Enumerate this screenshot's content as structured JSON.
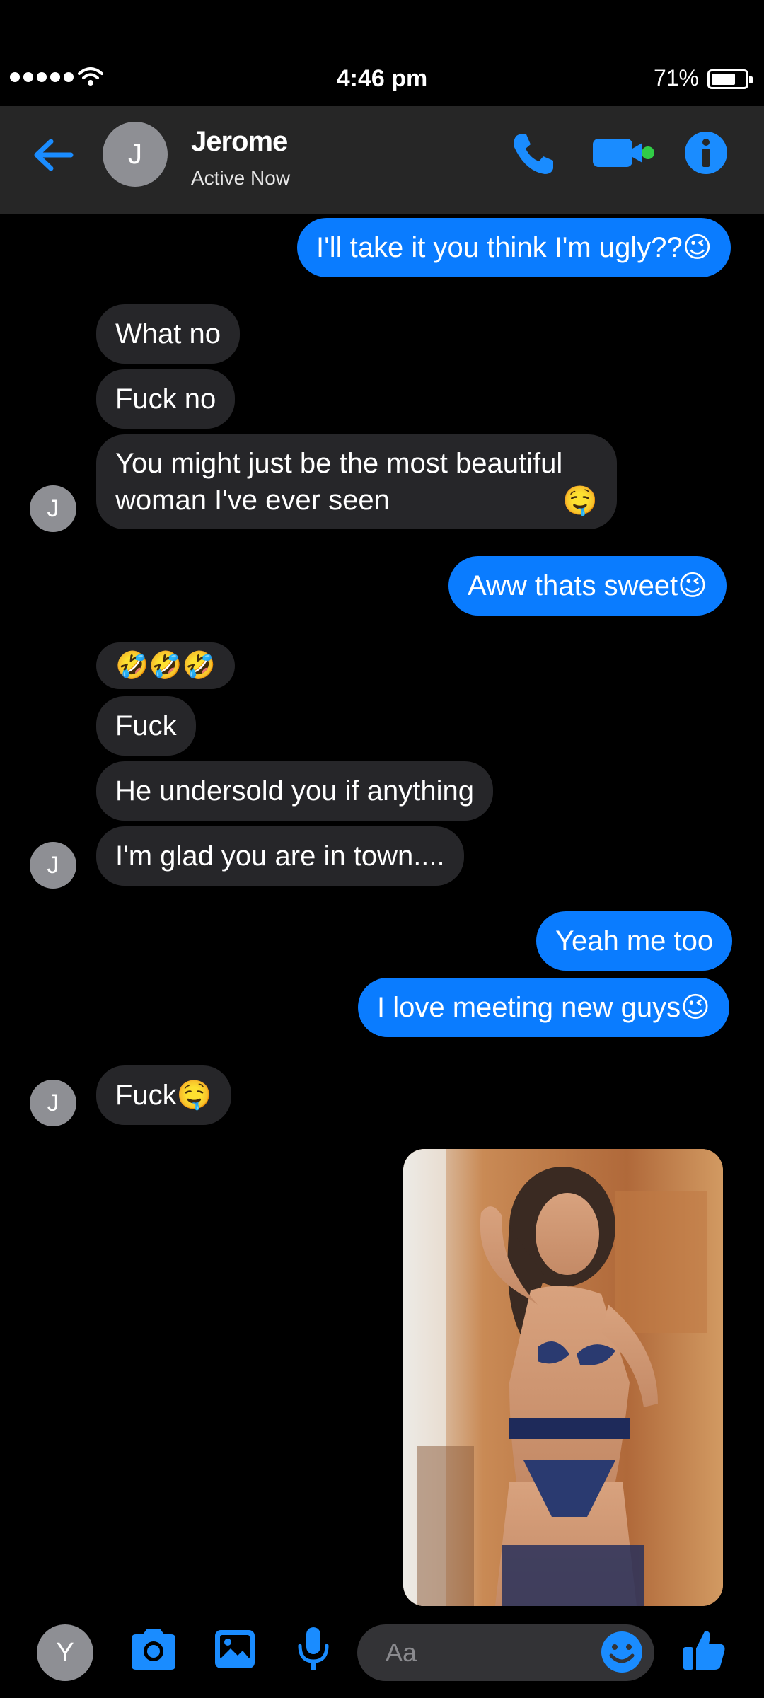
{
  "status_bar": {
    "time": "4:46 pm",
    "battery_percent": "71%",
    "battery_level": 0.71,
    "signal_icon": "signal-dots-icon",
    "wifi_icon": "wifi-icon"
  },
  "header": {
    "back_icon": "arrow-left-icon",
    "avatar_initial": "J",
    "name": "Jerome",
    "status": "Active Now",
    "call_icon": "phone-icon",
    "video_icon": "video-camera-icon",
    "info_icon": "info-icon"
  },
  "messages": [
    {
      "from": "me",
      "text": "I'll take it you think I'm ugly??",
      "emoji": "😉"
    },
    {
      "from": "them",
      "text": "What no",
      "emoji": ""
    },
    {
      "from": "them",
      "text": "Fuck no",
      "emoji": ""
    },
    {
      "from": "them",
      "text": "You might just be the most beautiful\nwoman I've ever seen",
      "emoji": "🤤"
    },
    {
      "from": "me",
      "text": "Aww thats sweet",
      "emoji": "😉"
    },
    {
      "from": "them",
      "text": "",
      "emoji": "🤣🤣🤣"
    },
    {
      "from": "them",
      "text": "Fuck",
      "emoji": ""
    },
    {
      "from": "them",
      "text": "He undersold you if anything",
      "emoji": ""
    },
    {
      "from": "them",
      "text": "I'm glad you are in town....",
      "emoji": ""
    },
    {
      "from": "me",
      "text": "Yeah me too",
      "emoji": ""
    },
    {
      "from": "me",
      "text": "I love meeting new guys",
      "emoji": "😉"
    },
    {
      "from": "them",
      "text": "Fuck",
      "emoji": "🤤"
    },
    {
      "from": "me",
      "type": "image"
    }
  ],
  "them_avatar_initial": "J",
  "composer": {
    "me_avatar_initial": "Y",
    "camera_icon": "camera-icon",
    "gallery_icon": "image-icon",
    "mic_icon": "microphone-icon",
    "placeholder": "Aa",
    "emoji_icon": "smiley-icon",
    "like_icon": "thumbs-up-icon"
  },
  "colors": {
    "accent": "#0a7cff",
    "header_bg": "#262626",
    "them_bubble": "#262629",
    "background": "#000000",
    "active_dot": "#31cc46"
  }
}
